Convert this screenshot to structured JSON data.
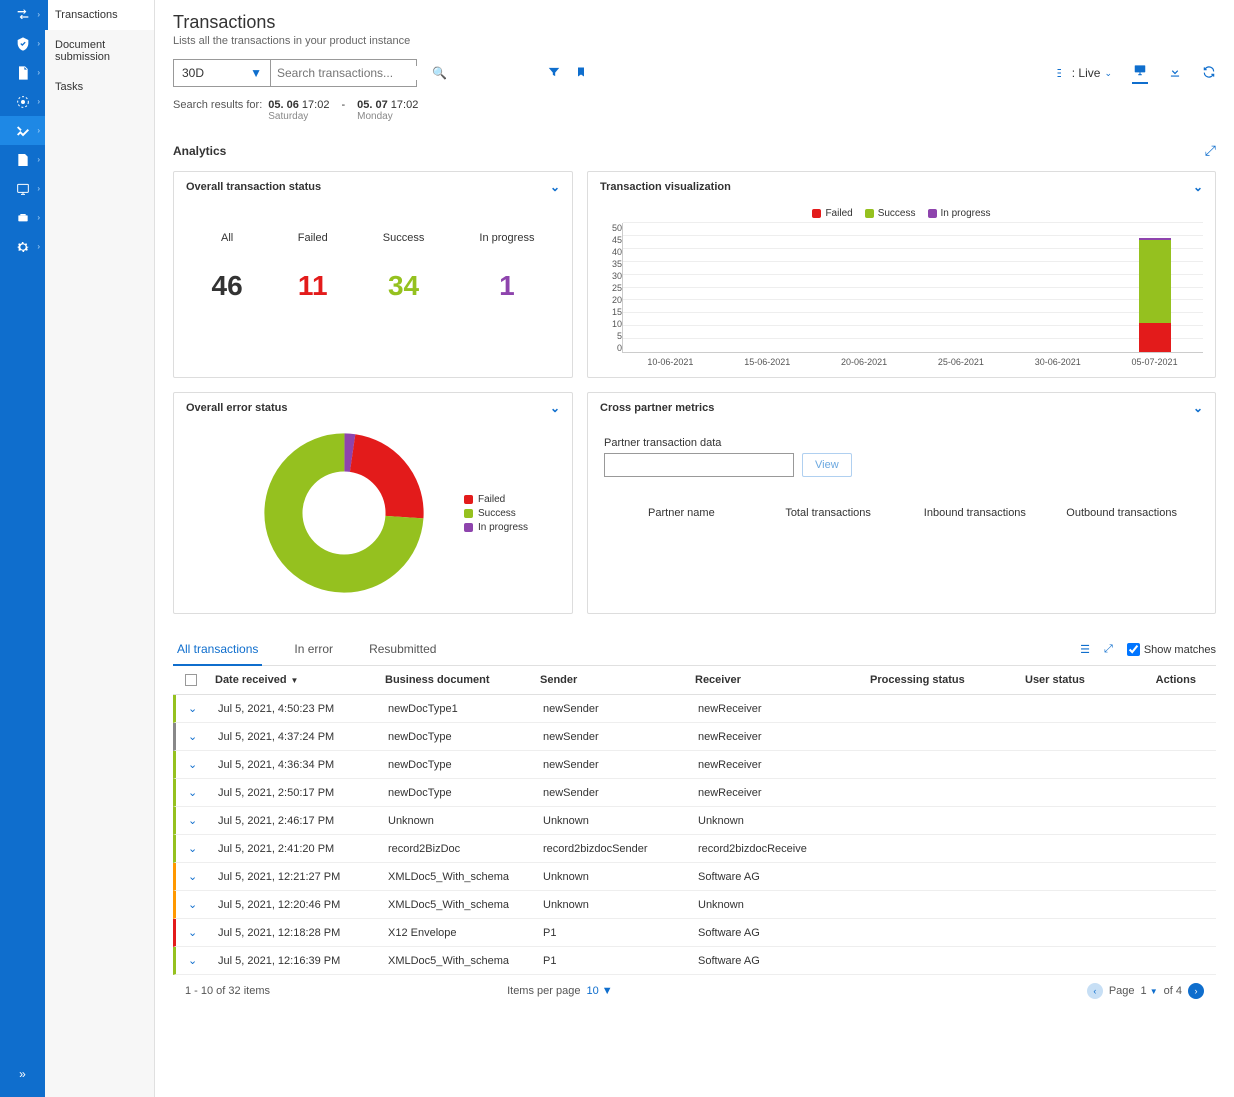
{
  "colors": {
    "primary": "#0f6ecd",
    "failed": "#e31b1b",
    "success": "#95c11f",
    "inprogress": "#8e44ad",
    "grey": "#888"
  },
  "subnav": {
    "items": [
      "Transactions",
      "Document submission",
      "Tasks"
    ],
    "active": 0
  },
  "page": {
    "title": "Transactions",
    "subtitle": "Lists all the transactions in your product instance"
  },
  "search": {
    "range": "30D",
    "placeholder": "Search transactions...",
    "live_label": ": Live",
    "results_label": "Search results for:",
    "from_date": "05. 06",
    "from_time": "17:02",
    "from_day": "Saturday",
    "to_date": "05. 07",
    "to_time": "17:02",
    "to_day": "Monday"
  },
  "analytics": {
    "title": "Analytics"
  },
  "overall_status": {
    "title": "Overall transaction status",
    "stats": [
      {
        "label": "All",
        "value": "46",
        "color": "#333"
      },
      {
        "label": "Failed",
        "value": "11",
        "color": "#e31b1b"
      },
      {
        "label": "Success",
        "value": "34",
        "color": "#95c11f"
      },
      {
        "label": "In progress",
        "value": "1",
        "color": "#8e44ad"
      }
    ]
  },
  "viz": {
    "title": "Transaction visualization",
    "legend": [
      {
        "name": "Failed",
        "color": "#e31b1b"
      },
      {
        "name": "Success",
        "color": "#95c11f"
      },
      {
        "name": "In progress",
        "color": "#8e44ad"
      }
    ]
  },
  "error_status": {
    "title": "Overall error status",
    "legend": [
      {
        "name": "Failed",
        "color": "#e31b1b"
      },
      {
        "name": "Success",
        "color": "#95c11f"
      },
      {
        "name": "In progress",
        "color": "#8e44ad"
      }
    ]
  },
  "partner": {
    "title": "Cross partner metrics",
    "field_label": "Partner transaction data",
    "view_btn": "View",
    "columns": [
      "Partner name",
      "Total transactions",
      "Inbound transactions",
      "Outbound transactions"
    ]
  },
  "table": {
    "tabs": [
      "All transactions",
      "In error",
      "Resubmitted"
    ],
    "active_tab": 0,
    "show_matches": "Show matches",
    "columns": [
      "Date received",
      "Business document",
      "Sender",
      "Receiver",
      "Processing status",
      "User status",
      "Actions"
    ],
    "rows": [
      {
        "status": "#95c11f",
        "date": "Jul 5, 2021, 4:50:23 PM",
        "doc": "newDocType1",
        "sender": "newSender",
        "receiver": "newReceiver"
      },
      {
        "status": "#888",
        "date": "Jul 5, 2021, 4:37:24 PM",
        "doc": "newDocType",
        "sender": "newSender",
        "receiver": "newReceiver"
      },
      {
        "status": "#95c11f",
        "date": "Jul 5, 2021, 4:36:34 PM",
        "doc": "newDocType",
        "sender": "newSender",
        "receiver": "newReceiver"
      },
      {
        "status": "#95c11f",
        "date": "Jul 5, 2021, 2:50:17 PM",
        "doc": "newDocType",
        "sender": "newSender",
        "receiver": "newReceiver"
      },
      {
        "status": "#95c11f",
        "date": "Jul 5, 2021, 2:46:17 PM",
        "doc": "Unknown",
        "sender": "Unknown",
        "receiver": "Unknown"
      },
      {
        "status": "#95c11f",
        "date": "Jul 5, 2021, 2:41:20 PM",
        "doc": "record2BizDoc",
        "sender": "record2bizdocSender",
        "receiver": "record2bizdocReceive"
      },
      {
        "status": "#ff9800",
        "date": "Jul 5, 2021, 12:21:27 PM",
        "doc": "XMLDoc5_With_schema",
        "sender": "Unknown",
        "receiver": "Software AG"
      },
      {
        "status": "#ff9800",
        "date": "Jul 5, 2021, 12:20:46 PM",
        "doc": "XMLDoc5_With_schema",
        "sender": "Unknown",
        "receiver": "Unknown"
      },
      {
        "status": "#e31b1b",
        "date": "Jul 5, 2021, 12:18:28 PM",
        "doc": "X12 Envelope",
        "sender": "P1",
        "receiver": "Software AG"
      },
      {
        "status": "#95c11f",
        "date": "Jul 5, 2021, 12:16:39 PM",
        "doc": "XMLDoc5_With_schema",
        "sender": "P1",
        "receiver": "Software AG"
      }
    ],
    "footer_showing": "1 - 10 of 32 items",
    "items_per_page_label": "Items per page",
    "items_per_page": "10",
    "page_label": "Page",
    "current_page": "1",
    "total_pages": "of 4"
  },
  "chart_data": [
    {
      "type": "bar",
      "title": "Transaction visualization",
      "categories": [
        "10-06-2021",
        "15-06-2021",
        "20-06-2021",
        "25-06-2021",
        "30-06-2021",
        "05-07-2021"
      ],
      "series": [
        {
          "name": "Failed",
          "values": [
            0,
            0,
            0,
            0,
            0,
            11
          ]
        },
        {
          "name": "Success",
          "values": [
            0,
            0,
            0,
            0,
            0,
            32
          ]
        },
        {
          "name": "In progress",
          "values": [
            0,
            0,
            0,
            0,
            0,
            1
          ]
        }
      ],
      "ylim": [
        0,
        50
      ],
      "y_ticks": [
        0,
        5,
        10,
        15,
        20,
        25,
        30,
        35,
        40,
        45,
        50
      ],
      "stacked": true
    },
    {
      "type": "pie",
      "title": "Overall error status",
      "series": [
        {
          "name": "Failed",
          "value": 11
        },
        {
          "name": "Success",
          "value": 34
        },
        {
          "name": "In progress",
          "value": 1
        }
      ],
      "donut": true
    }
  ]
}
